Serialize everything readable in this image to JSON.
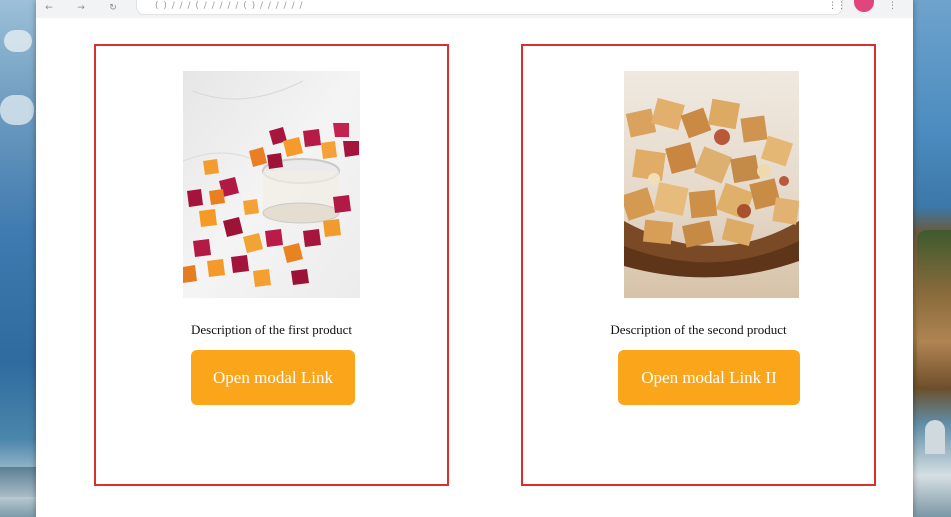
{
  "browser": {
    "address_text": "( ) / / / ( / / / / / ( ) / / / / / / ",
    "extension_glyph": "⋮⋮",
    "menu_glyph": "⋮",
    "nav_back": "←",
    "nav_forward": "→",
    "nav_reload": "↻"
  },
  "products": [
    {
      "image": "fruit-gummies-image",
      "description": "Description of the first product",
      "button_label": "Open modal Link"
    },
    {
      "image": "snack-mix-image",
      "description": "Description of the second product",
      "button_label": "Open modal Link II"
    }
  ],
  "colors": {
    "card_border": "#d9302f",
    "button_bg": "#fba61a",
    "button_text": "#ffffff"
  }
}
